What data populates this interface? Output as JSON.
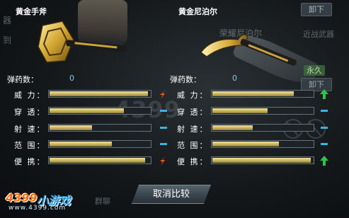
{
  "background": {
    "side_labels": [
      "器",
      "到"
    ],
    "top_right_button": "卸下",
    "top_right_button_2": "卸下",
    "faded_title": "荣耀尼泊尔",
    "faded_subtitle": "近战武器",
    "permanent_badge": "永久",
    "faded_unequip": "卸下",
    "bottom_faded_text": "群聊"
  },
  "watermark": "4399",
  "left": {
    "name": "黄金手斧",
    "ammo_label": "弹药数：",
    "ammo_value": "0",
    "stats": [
      {
        "label": "威 力：",
        "value": 0.98,
        "indicator": "down"
      },
      {
        "label": "穿 透：",
        "value": 0.74,
        "indicator": "dash"
      },
      {
        "label": "射 速：",
        "value": 0.42,
        "indicator": "dash"
      },
      {
        "label": "范 围：",
        "value": 0.62,
        "indicator": "dash"
      },
      {
        "label": "便 携：",
        "value": 0.95,
        "indicator": "down"
      }
    ]
  },
  "right": {
    "name": "黄金尼泊尔",
    "ammo_label": "弹药数：",
    "ammo_value": "0",
    "stats": [
      {
        "label": "威 力：",
        "value": 0.81,
        "indicator": "up"
      },
      {
        "label": "穿 透：",
        "value": 0.55,
        "indicator": "dash"
      },
      {
        "label": "射 速：",
        "value": 0.4,
        "indicator": "dash"
      },
      {
        "label": "范 围：",
        "value": 0.66,
        "indicator": "dash"
      },
      {
        "label": "便 携：",
        "value": 0.98,
        "indicator": "up"
      }
    ]
  },
  "cancel_button": "取消比较",
  "logo": {
    "brand_a": "4399",
    "brand_b": "小游戏",
    "url": "www.4399.com"
  },
  "colors": {
    "bar": "#d8c56f",
    "up": "#2ec24a",
    "down": "#ff5a14",
    "dash": "#3bb3e6"
  }
}
